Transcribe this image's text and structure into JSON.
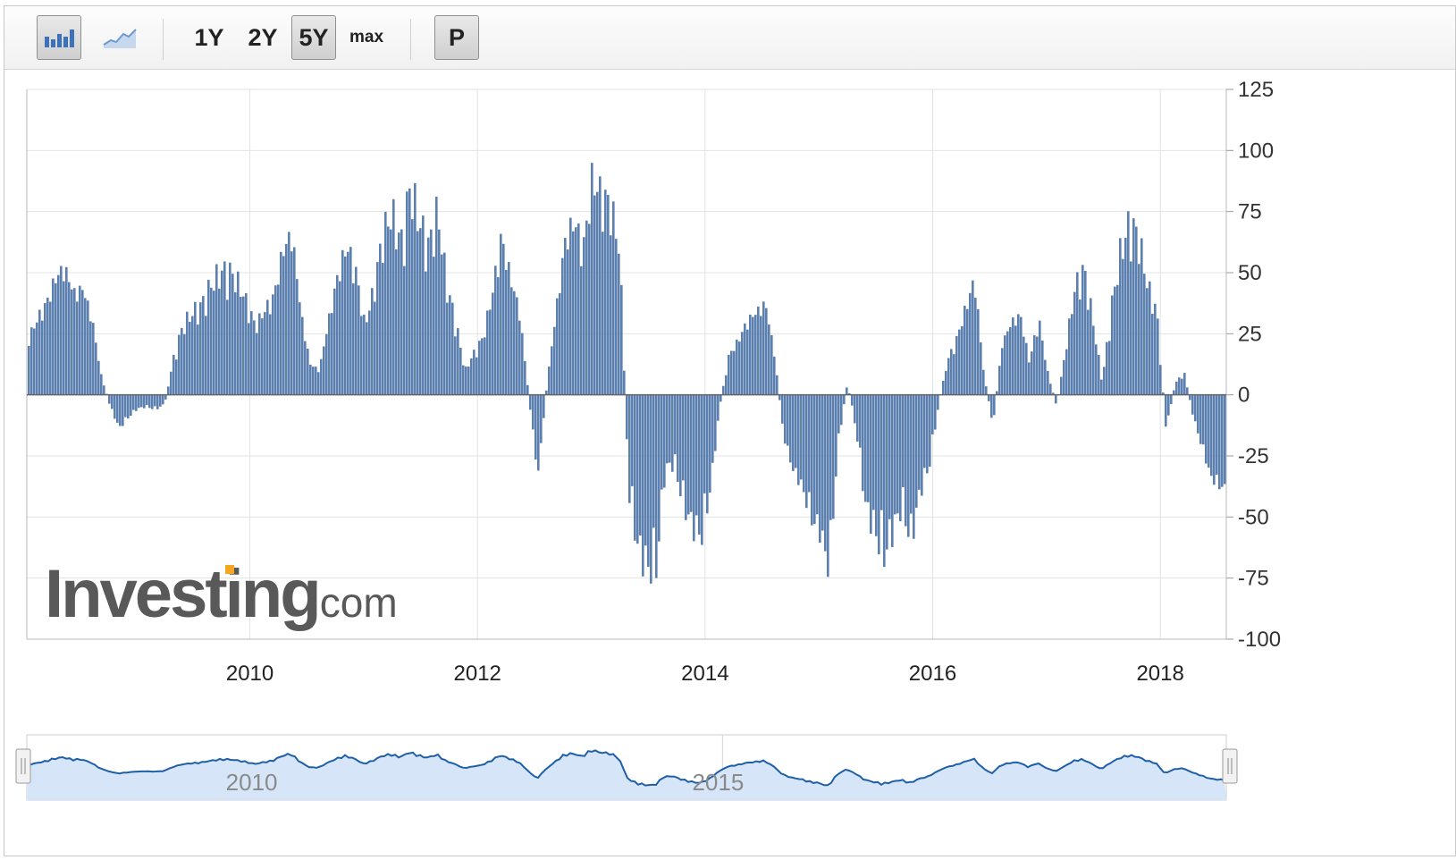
{
  "toolbar": {
    "bar_chart_icon": "bar-chart-icon",
    "line_chart_icon": "line-chart-icon",
    "range_1y": "1Y",
    "range_2y": "2Y",
    "range_5y": "5Y",
    "range_max": "max",
    "p_button": "P",
    "selected_range": "5Y"
  },
  "logo": {
    "brand": "Investing",
    "domain": ".com",
    "accent_color": "#f5a623"
  },
  "colors": {
    "bar": "#5b7fae",
    "navigator_line": "#1f5fa8",
    "navigator_fill": "#d6e6f8",
    "grid": "#e3e3e3"
  },
  "navigator": {
    "tick_labels": [
      "2010",
      "2015"
    ]
  },
  "chart_data": {
    "type": "bar",
    "title": "",
    "xlabel": "",
    "ylabel": "",
    "ylim": [
      -100,
      125
    ],
    "yticks": [
      125,
      100,
      75,
      50,
      25,
      0,
      -25,
      -50,
      -75,
      -100
    ],
    "ytick_labels": [
      "125",
      "100",
      "75",
      "50",
      "25",
      "0",
      "-25",
      "-50",
      "-75",
      "-100"
    ],
    "xlim": [
      2008.04,
      2018.58
    ],
    "xticks": [
      2010,
      2012,
      2014,
      2016,
      2018
    ],
    "xtick_labels": [
      "2010",
      "2012",
      "2014",
      "2016",
      "2018"
    ],
    "grid": true,
    "series": [
      {
        "x": [
          2008.04,
          2008.12,
          2008.2,
          2008.28,
          2008.36,
          2008.44,
          2008.52,
          2008.6,
          2008.68,
          2008.76,
          2008.84,
          2008.92,
          2009.0,
          2009.08,
          2009.16,
          2009.24,
          2009.32,
          2009.4,
          2009.48,
          2009.56,
          2009.64,
          2009.72,
          2009.8,
          2009.88,
          2009.96,
          2010.04,
          2010.12,
          2010.2,
          2010.28,
          2010.36,
          2010.44,
          2010.52,
          2010.6,
          2010.68,
          2010.76,
          2010.84,
          2010.92,
          2011.0,
          2011.08,
          2011.16,
          2011.24,
          2011.32,
          2011.4,
          2011.48,
          2011.56,
          2011.64,
          2011.72,
          2011.8,
          2011.88,
          2011.96,
          2012.04,
          2012.12,
          2012.2,
          2012.28,
          2012.36,
          2012.44,
          2012.52,
          2012.6,
          2012.68,
          2012.76,
          2012.84,
          2012.92,
          2013.0,
          2013.08,
          2013.16,
          2013.24,
          2013.32,
          2013.4,
          2013.48,
          2013.56,
          2013.64,
          2013.72,
          2013.8,
          2013.88,
          2013.96,
          2014.04,
          2014.12,
          2014.2,
          2014.28,
          2014.36,
          2014.44,
          2014.52,
          2014.6,
          2014.68,
          2014.76,
          2014.84,
          2014.92,
          2015.0,
          2015.08,
          2015.16,
          2015.24,
          2015.32,
          2015.4,
          2015.48,
          2015.56,
          2015.64,
          2015.72,
          2015.8,
          2015.88,
          2015.96,
          2016.04,
          2016.12,
          2016.2,
          2016.28,
          2016.36,
          2016.44,
          2016.52,
          2016.6,
          2016.68,
          2016.76,
          2016.84,
          2016.92,
          2017.0,
          2017.08,
          2017.16,
          2017.24,
          2017.32,
          2017.4,
          2017.48,
          2017.56,
          2017.64,
          2017.72,
          2017.8,
          2017.88,
          2017.96,
          2018.04,
          2018.12,
          2018.2,
          2018.28,
          2018.36,
          2018.44,
          2018.52,
          2018.58
        ],
        "values": [
          24,
          34,
          42,
          55,
          62,
          50,
          52,
          38,
          10,
          -5,
          -15,
          -10,
          -6,
          -5,
          -6,
          -4,
          15,
          28,
          33,
          36,
          44,
          50,
          52,
          48,
          40,
          30,
          38,
          45,
          68,
          78,
          40,
          15,
          12,
          35,
          55,
          68,
          55,
          30,
          45,
          68,
          75,
          62,
          85,
          70,
          60,
          75,
          45,
          30,
          10,
          18,
          25,
          45,
          72,
          55,
          40,
          0,
          -40,
          5,
          40,
          72,
          80,
          65,
          95,
          85,
          80,
          60,
          -40,
          -62,
          -70,
          -70,
          -30,
          -28,
          -45,
          -55,
          -60,
          -40,
          -5,
          18,
          25,
          35,
          40,
          45,
          20,
          -20,
          -35,
          -42,
          -55,
          -60,
          -75,
          -20,
          5,
          -15,
          -45,
          -55,
          -65,
          -55,
          -45,
          -60,
          -40,
          -30,
          -5,
          15,
          25,
          40,
          55,
          10,
          -15,
          25,
          35,
          38,
          15,
          35,
          10,
          -5,
          20,
          45,
          52,
          30,
          5,
          35,
          58,
          70,
          65,
          45,
          35,
          -15,
          5,
          10,
          -10,
          -25,
          -40,
          -45,
          -45
        ]
      }
    ]
  }
}
